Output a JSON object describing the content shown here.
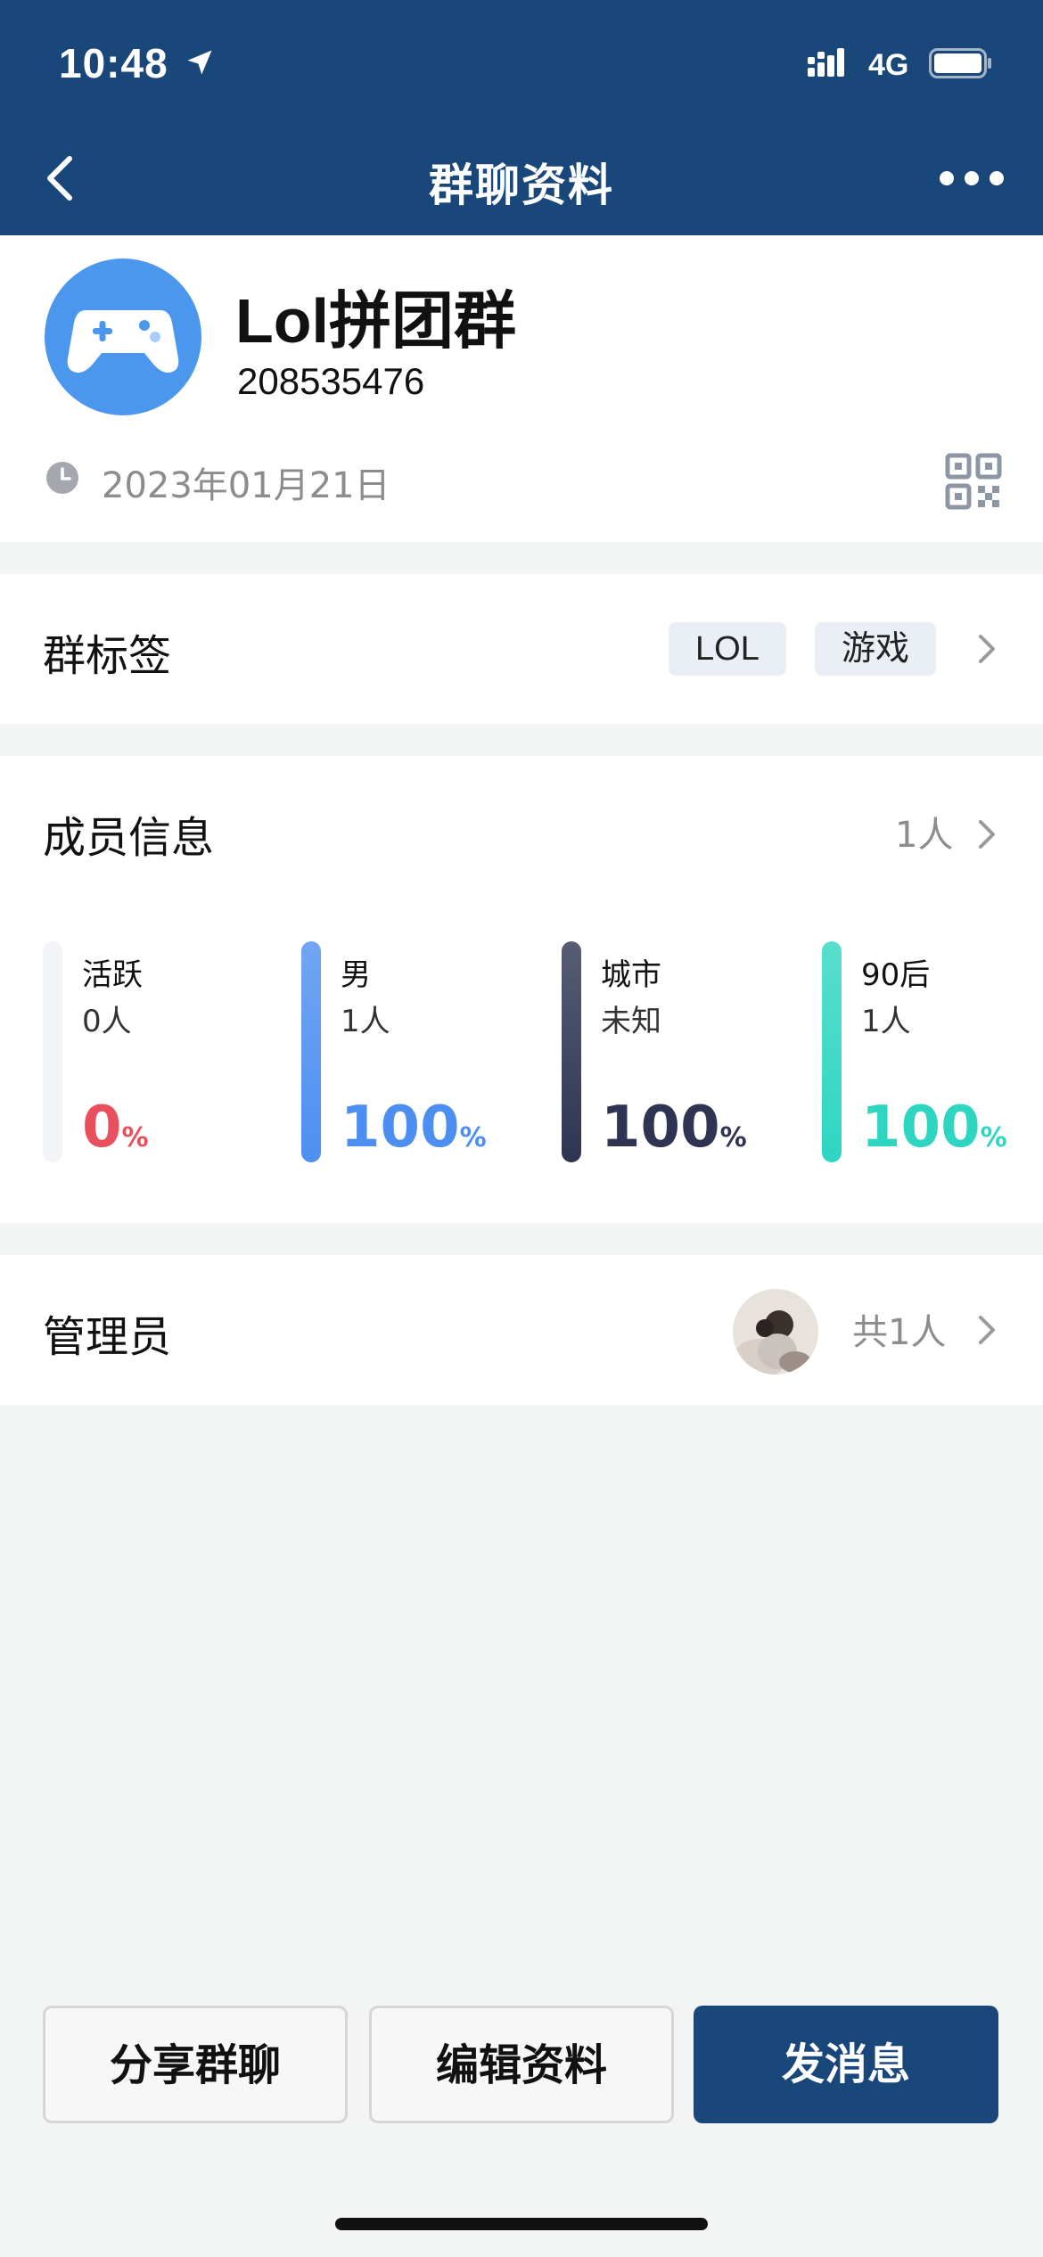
{
  "status_bar": {
    "time": "10:48",
    "network": "4G"
  },
  "nav": {
    "title": "群聊资料"
  },
  "group": {
    "name": "Lol拼团群",
    "id": "208535476",
    "created_date": "2023年01月21日"
  },
  "tags": {
    "label": "群标签",
    "items": [
      "LOL",
      "游戏"
    ]
  },
  "members": {
    "label": "成员信息",
    "count": "1人",
    "stats": [
      {
        "label": "活跃",
        "sub": "0人",
        "value": "0",
        "unit": "%",
        "percent": 0,
        "color": "#e9505d"
      },
      {
        "label": "男",
        "sub": "1人",
        "value": "100",
        "unit": "%",
        "percent": 100,
        "color": "#4d8ff0"
      },
      {
        "label": "城市",
        "sub": "未知",
        "value": "100",
        "unit": "%",
        "percent": 100,
        "color": "#2e3452"
      },
      {
        "label": "90后",
        "sub": "1人",
        "value": "100",
        "unit": "%",
        "percent": 100,
        "color": "#2ed6c1"
      }
    ]
  },
  "admins": {
    "label": "管理员",
    "count": "共1人"
  },
  "actions": {
    "share": "分享群聊",
    "edit": "编辑资料",
    "send": "发消息"
  }
}
